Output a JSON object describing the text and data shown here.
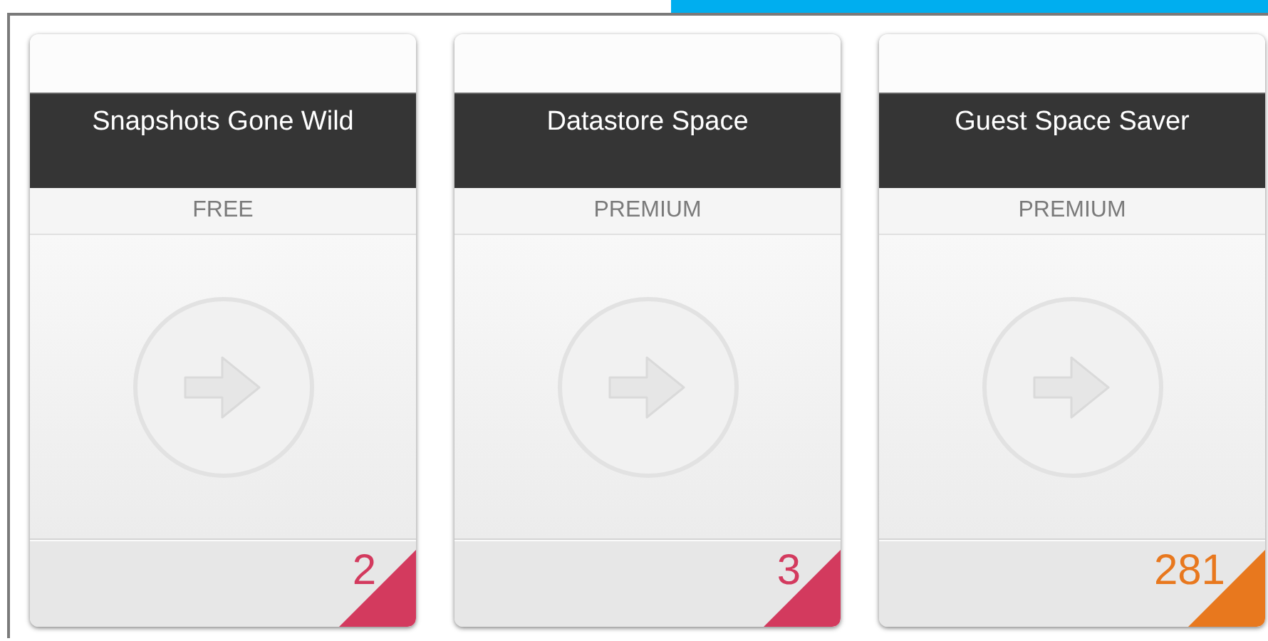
{
  "cards": [
    {
      "title": "Snapshots Gone Wild",
      "tier": "FREE",
      "count": "2",
      "color": "#d33a5e"
    },
    {
      "title": "Datastore Space",
      "tier": "PREMIUM",
      "count": "3",
      "color": "#d33a5e"
    },
    {
      "title": "Guest Space Saver",
      "tier": "PREMIUM",
      "count": "281",
      "color": "#e8781e"
    }
  ]
}
